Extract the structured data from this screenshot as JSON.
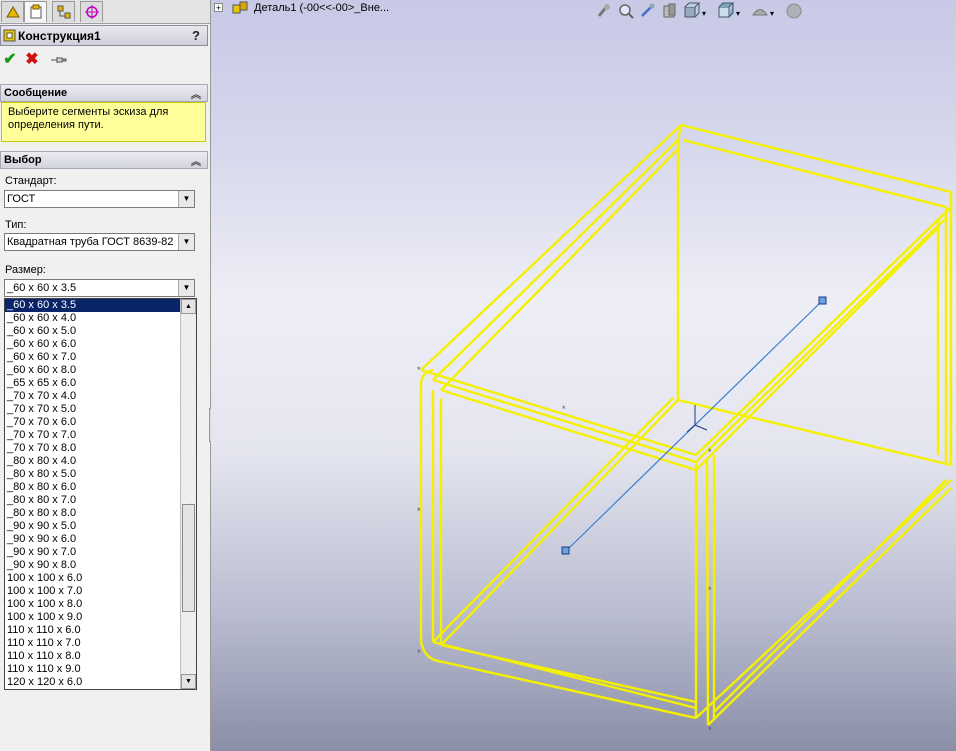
{
  "property_manager": {
    "tabs": [
      "feature-manager",
      "property-manager",
      "configuration-manager",
      "dim-xpert-manager"
    ],
    "title": "Конструкция1",
    "help_label": "?",
    "actions": {
      "ok": "✔",
      "cancel": "✖",
      "pin": "pin"
    },
    "message_group": {
      "title": "Сообщение",
      "text": "Выберите сегменты эскиза для определения пути."
    },
    "selection_group": {
      "title": "Выбор",
      "standard_label": "Стандарт:",
      "standard_value": "ГОСТ",
      "type_label": "Тип:",
      "type_value": "Квадратная труба ГОСТ 8639-82",
      "size_label": "Размер:",
      "size_value": "_60 x 60 x 3.5",
      "size_options": [
        "_60 x 60 x 3.5",
        "_60 x 60 x 4.0",
        "_60 x 60 x 5.0",
        "_60 x 60 x 6.0",
        "_60 x 60 x 7.0",
        "_60 x 60 x 8.0",
        "_65 x 65 x 6.0",
        "_70 x 70 x 4.0",
        "_70 x 70 x 5.0",
        "_70 x 70 x 6.0",
        "_70 x 70 x 7.0",
        "_70 x 70 x 8.0",
        "_80 x 80 x 4.0",
        "_80 x 80 x 5.0",
        "_80 x 80 x 6.0",
        "_80 x 80 x 7.0",
        "_80 x 80 x 8.0",
        "_90 x 90 x 5.0",
        "_90 x 90 x 6.0",
        "_90 x 90 x 7.0",
        "_90 x 90 x 8.0",
        "100 x 100 x 6.0",
        "100 x 100 x 7.0",
        "100 x 100 x 8.0",
        "100 x 100 x 9.0",
        "110 x 110 x 6.0",
        "110 x 110 x 7.0",
        "110 x 110 x 8.0",
        "110 x 110 x 9.0",
        "120 x 120 x 6.0"
      ],
      "selected_index": 0
    }
  },
  "graphics": {
    "tree_root_label": "Деталь1  (-00<<-00>_Вне...",
    "tree_expand": "+",
    "hud_icons": [
      "zoom-to-fit-icon",
      "zoom-area-icon",
      "previous-view-icon",
      "section-view-icon",
      "view-orientation-icon",
      "display-style-icon",
      "hide-show-items-icon",
      "appearance-icon"
    ],
    "colors": {
      "frame": "#f4f000",
      "sketch_line": "#3a7fd0",
      "background_top": "#c7c9e6",
      "background_bottom": "#8a8ea6"
    }
  }
}
